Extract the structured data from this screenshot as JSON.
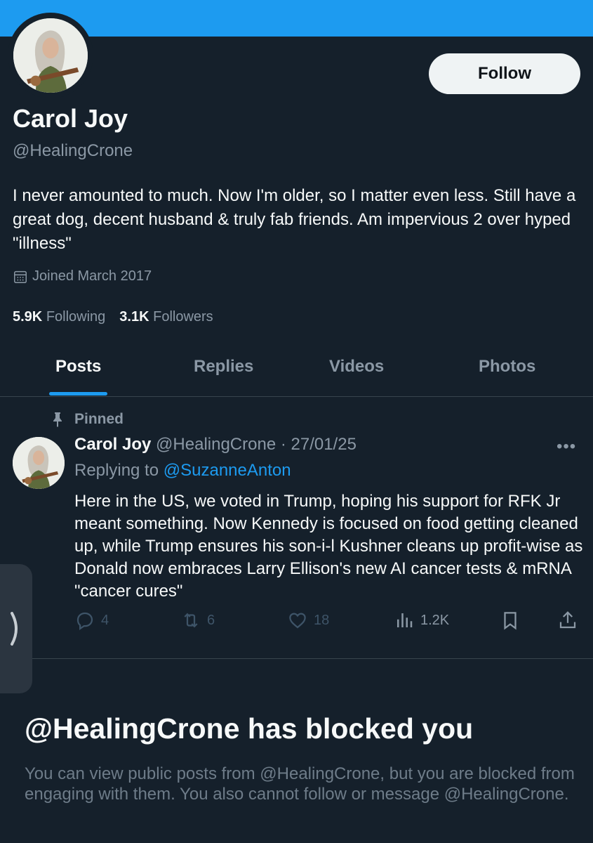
{
  "profile": {
    "display_name": "Carol Joy",
    "handle": "@HealingCrone",
    "bio": "I never amounted to much. Now I'm older, so I matter even less. Still have a great dog, decent husband & truly fab friends. Am impervious 2 over hyped \"illness\"",
    "joined": "Joined March 2017",
    "following_count": "5.9K",
    "following_label": "Following",
    "followers_count": "3.1K",
    "followers_label": "Followers",
    "follow_label": "Follow"
  },
  "tabs": [
    {
      "label": "Posts",
      "active": true
    },
    {
      "label": "Replies",
      "active": false
    },
    {
      "label": "Videos",
      "active": false
    },
    {
      "label": "Photos",
      "active": false
    }
  ],
  "post": {
    "pinned_label": "Pinned",
    "author_name": "Carol Joy",
    "author_handle": "@HealingCrone",
    "date_separator": " · ",
    "date": "27/01/25",
    "more_label": "•••",
    "replying_prefix": "Replying to ",
    "replying_to": "@SuzanneAnton",
    "text": "Here in the US, we voted in Trump, hoping his support for RFK Jr meant something. Now Kennedy is focused on food getting cleaned up, while Trump ensures his son-i-l Kushner cleans up profit-wise as Donald now embraces Larry Ellison's new AI cancer tests & mRNA \"cancer cures\"",
    "replies": "4",
    "reposts": "6",
    "likes": "18",
    "views": "1.2K"
  },
  "blocked": {
    "title": "@HealingCrone has blocked you",
    "description": "You can view public posts from @HealingCrone, but you are blocked from engaging with them. You also cannot follow or message @HealingCrone."
  },
  "colors": {
    "background": "#15202b",
    "banner": "#1d9bf0",
    "accent": "#1d9bf0",
    "muted_text": "#8b98a5"
  },
  "icons": [
    "calendar-icon",
    "pin-icon",
    "reply-icon",
    "repost-icon",
    "like-icon",
    "views-icon",
    "bookmark-icon",
    "share-icon",
    "chevron-right-icon"
  ]
}
